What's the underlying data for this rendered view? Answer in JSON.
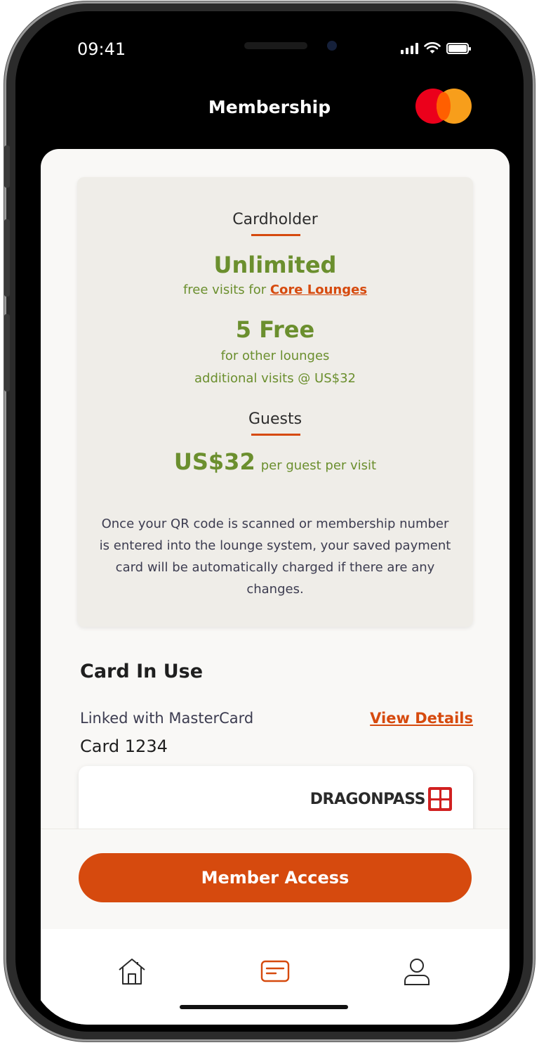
{
  "status_bar": {
    "time": "09:41"
  },
  "header": {
    "title": "Membership",
    "logo_icon": "mastercard-logo"
  },
  "benefits": {
    "cardholder_label": "Cardholder",
    "core_headline": "Unlimited",
    "core_sub_prefix": "free visits for ",
    "core_link": "Core Lounges",
    "other_headline": "5 Free",
    "other_sub1": "for other lounges",
    "other_sub2": "additional visits @ US$32",
    "guests_label": "Guests",
    "guest_price": "US$32",
    "guest_sub": "per guest per visit",
    "disclaimer": "Once your QR code is scanned or membership number is entered into the lounge system, your saved payment card will be automatically charged if there are any changes."
  },
  "card_in_use": {
    "title": "Card In Use",
    "linked_text": "Linked with MasterCard",
    "view_details": "View Details",
    "card_number": "Card 1234",
    "brand": "DRAGONPASS"
  },
  "actions": {
    "member_access": "Member Access"
  },
  "tabs": [
    {
      "icon": "home-icon"
    },
    {
      "icon": "card-icon",
      "active": true
    },
    {
      "icon": "profile-icon"
    }
  ],
  "colors": {
    "accent": "#d64a0e",
    "green": "#6b8f2e",
    "panel": "#efede8"
  }
}
